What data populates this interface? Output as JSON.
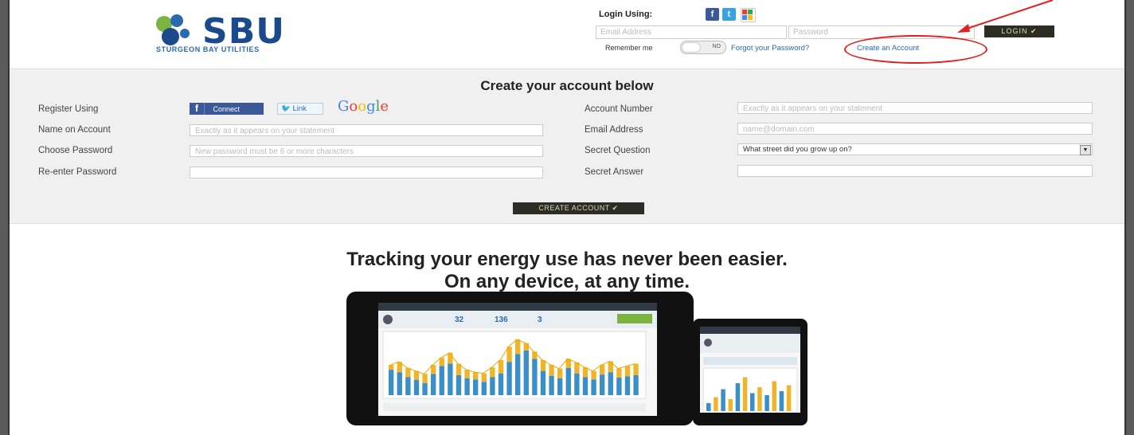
{
  "brand": {
    "name": "SBU",
    "tagline": "STURGEON BAY UTILITIES",
    "colors": {
      "primary": "#1b4a8c",
      "accent": "#2a6bb0",
      "green": "#7cb342",
      "highlight_ring": "#e12020"
    }
  },
  "header": {
    "login_label": "Login Using:",
    "social_icons": [
      "facebook-icon",
      "twitter-icon",
      "google-icon"
    ],
    "email_placeholder": "Email Address",
    "password_placeholder": "Password",
    "login_button": "LOGIN ✔",
    "remember_label": "Remember me",
    "remember_toggle": "NO",
    "forgot_link": "Forgot your Password?",
    "create_link": "Create an Account"
  },
  "form": {
    "title": "Create your account below",
    "register_label": "Register Using",
    "fb_connect": "Connect",
    "twitter_link": "Link",
    "google_label": "Google",
    "name_label": "Name on Account",
    "name_placeholder": "Exactly as it appears on your statement",
    "password_label": "Choose Password",
    "password_placeholder": "New password must be 6 or more characters",
    "reenter_label": "Re-enter Password",
    "reenter_placeholder": "",
    "account_label": "Account Number",
    "account_placeholder": "Exactly as it appears on your statement",
    "email_label": "Email Address",
    "email_placeholder": "name@domain.com",
    "question_label": "Secret Question",
    "question_selected": "What street did you grow up on?",
    "answer_label": "Secret Answer",
    "answer_placeholder": "",
    "submit": "CREATE ACCOUNT ✔"
  },
  "promo": {
    "line1": "Tracking your energy use has never been easier.",
    "line2": "On any device, at any time."
  },
  "device_preview": {
    "stats": [
      "32",
      "136",
      "3"
    ],
    "tablet_bars": [
      0.42,
      0.38,
      0.3,
      0.25,
      0.2,
      0.35,
      0.48,
      0.52,
      0.33,
      0.28,
      0.26,
      0.22,
      0.3,
      0.36,
      0.55,
      0.68,
      0.74,
      0.6,
      0.4,
      0.32,
      0.28,
      0.45,
      0.36,
      0.3,
      0.26,
      0.34,
      0.38,
      0.29,
      0.31,
      0.33
    ],
    "tablet_line": [
      0.5,
      0.55,
      0.45,
      0.4,
      0.35,
      0.5,
      0.62,
      0.7,
      0.52,
      0.42,
      0.38,
      0.36,
      0.46,
      0.58,
      0.8,
      0.92,
      0.86,
      0.72,
      0.58,
      0.5,
      0.44,
      0.6,
      0.54,
      0.46,
      0.4,
      0.5,
      0.56,
      0.44,
      0.48,
      0.52
    ],
    "phone_bars": [
      0.2,
      0.35,
      0.55,
      0.3,
      0.7,
      0.85,
      0.45,
      0.6,
      0.4,
      0.75,
      0.5,
      0.65
    ]
  }
}
